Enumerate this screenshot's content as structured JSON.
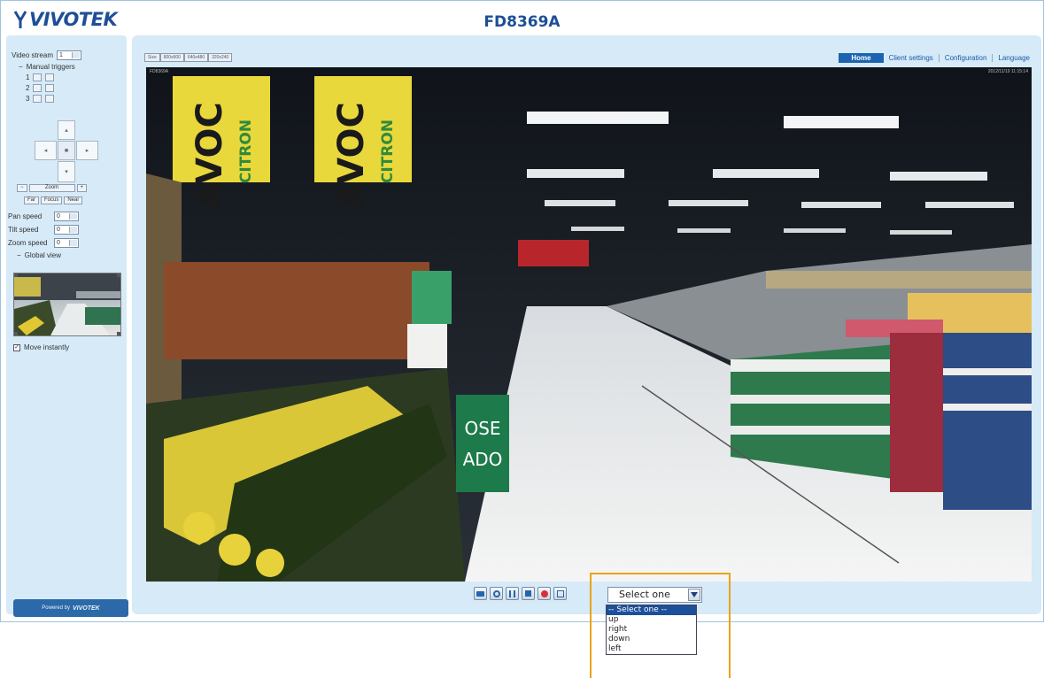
{
  "header": {
    "logo_text": "VIVOTEK",
    "model": "FD8369A"
  },
  "left_panel": {
    "video_stream_label": "Video stream",
    "video_stream_value": "1",
    "manual_triggers_label": "Manual triggers",
    "trigger_numbers": [
      "1",
      "2",
      "3"
    ],
    "zoom_row": [
      "Zoom"
    ],
    "focus_row": [
      "Far",
      "Focus",
      "Near"
    ],
    "pan_speed_label": "Pan speed",
    "pan_speed_value": "0",
    "tilt_speed_label": "Tilt speed",
    "tilt_speed_value": "0",
    "zoom_speed_label": "Zoom speed",
    "zoom_speed_value": "0",
    "global_view_label": "Global view",
    "move_instantly_label": "Move instantly",
    "powered_by": "Powered by",
    "powered_brand": "VIVOTEK"
  },
  "nav": {
    "home": "Home",
    "client_settings": "Client settings",
    "configuration": "Configuration",
    "language": "Language"
  },
  "view_size_buttons": [
    "Size",
    "800x600",
    "640x480",
    "320x240"
  ],
  "video": {
    "caption": "FD8369A",
    "timestamp": "2012/11/19 11:15:14",
    "sign_left_1": "AVOC",
    "sign_left_2": "CITRON",
    "sign_green": "OSE ADO"
  },
  "toolbar": {
    "select_value": "Select one",
    "options": [
      "-- Select one --",
      "up",
      "right",
      "down",
      "left"
    ]
  },
  "colors": {
    "accent": "#1c64b0",
    "panel": "#d6eaf8",
    "highlight": "#e8a419"
  }
}
